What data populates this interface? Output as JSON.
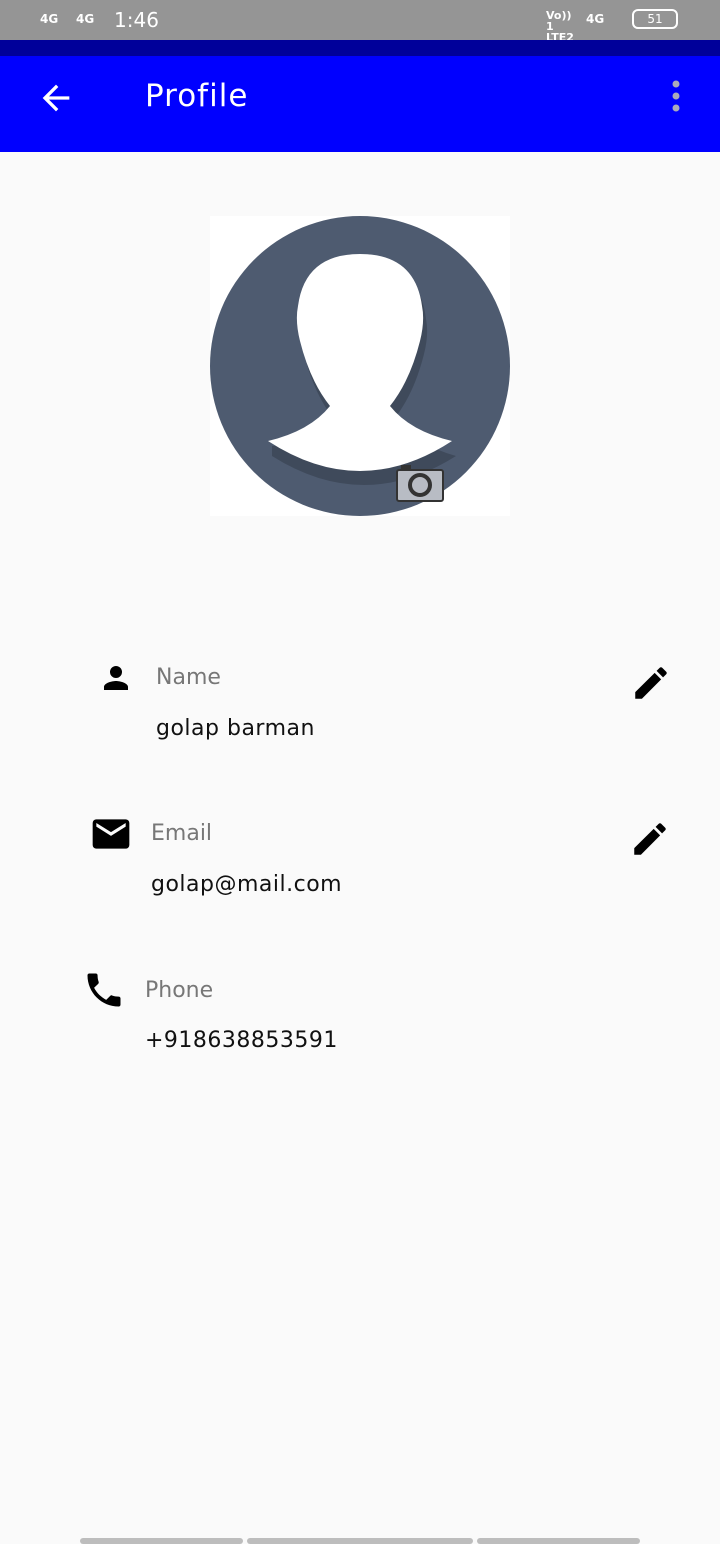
{
  "status_bar": {
    "net1": "4G",
    "net2": "4G",
    "time": "1:46",
    "volte": "Vo)) 1 LTE2",
    "net3": "4G",
    "battery": "51"
  },
  "app_bar": {
    "title": "Profile",
    "back_icon": "arrow-left-icon",
    "menu_icon": "more-vert-icon"
  },
  "avatar": {
    "camera_icon": "camera-icon"
  },
  "fields": [
    {
      "label": "Name",
      "value": "golap barman",
      "icon": "person-icon",
      "editable": true
    },
    {
      "label": "Email",
      "value": "golap@mail.com",
      "icon": "mail-icon",
      "editable": true
    },
    {
      "label": "Phone",
      "value": "+918638853591",
      "icon": "phone-icon",
      "editable": false
    }
  ],
  "colors": {
    "primary": "#0000ff",
    "status_dark": "#00009a",
    "avatar": "#4e5b70"
  }
}
